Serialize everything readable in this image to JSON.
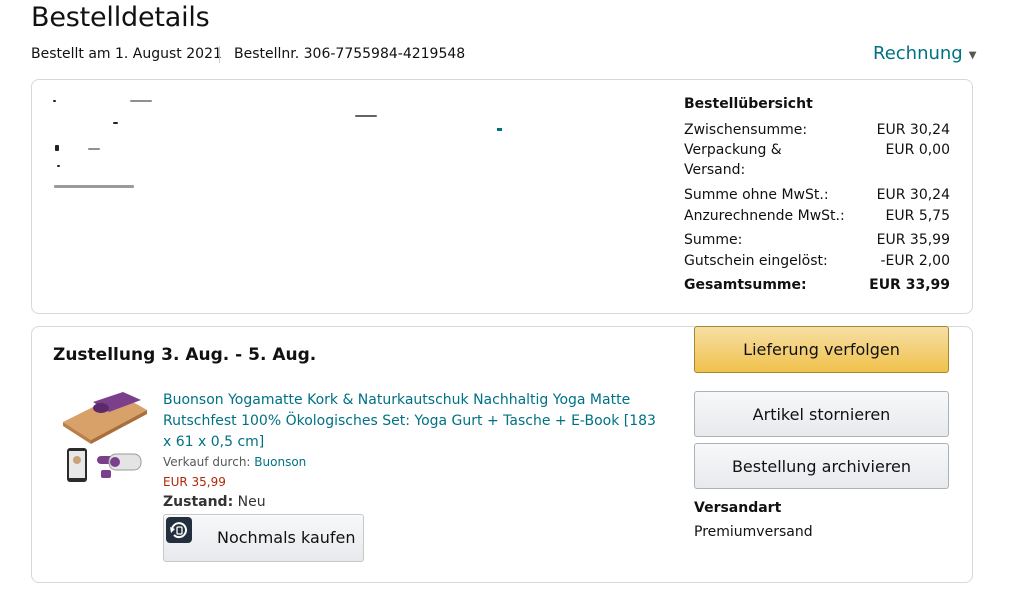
{
  "page": {
    "title": "Bestelldetails",
    "ordered_on": "Bestellt am 1. August 2021",
    "order_number": "Bestellnr. 306-7755984-4219548",
    "invoice_label": "Rechnung"
  },
  "summary": {
    "title": "Bestellübersicht",
    "rows": [
      {
        "label": "Zwischensumme:",
        "value": "EUR 30,24"
      },
      {
        "label": "Verpackung & Versand:",
        "value": "EUR 0,00"
      },
      {
        "label": "Summe ohne MwSt.:",
        "value": "EUR 30,24"
      },
      {
        "label": "Anzurechnende MwSt.:",
        "value": "EUR 5,75"
      },
      {
        "label": "Summe:",
        "value": "EUR 35,99"
      },
      {
        "label": "Gutschein eingelöst:",
        "value": "-EUR 2,00"
      },
      {
        "label": "Gesamtsumme:",
        "value": "EUR 33,99"
      }
    ]
  },
  "shipment": {
    "delivery": "Zustellung 3. Aug. - 5. Aug.",
    "product_title": "Buonson Yogamatte Kork & Naturkautschuk Nachhaltig Yoga Matte Rutschfest 100% Ökologisches Set: Yoga Gurt + Tasche + E-Book [183 x 61 x 0,5 cm]",
    "seller_prefix": "Verkauf durch:",
    "seller": "Buonson",
    "price": "EUR 35,99",
    "condition_label": "Zustand:",
    "condition_value": "Neu",
    "buy_again": "Nochmals kaufen",
    "track": "Lieferung verfolgen",
    "cancel": "Artikel stornieren",
    "archive": "Bestellung archivieren",
    "shipping_method_title": "Versandart",
    "shipping_method": "Premiumversand"
  },
  "colors": {
    "link": "#007185",
    "price": "#B12704",
    "track_button": "#f0c14b"
  }
}
